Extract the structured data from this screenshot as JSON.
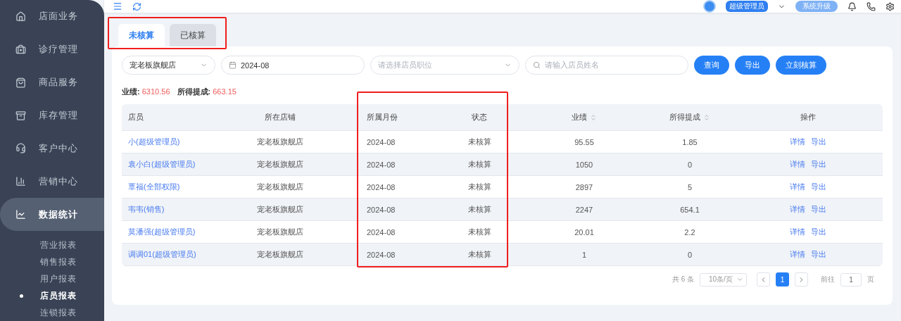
{
  "sidebar": {
    "items": [
      {
        "label": "店面业务",
        "selected": false
      },
      {
        "label": "诊疗管理",
        "selected": false
      },
      {
        "label": "商品服务",
        "selected": false
      },
      {
        "label": "库存管理",
        "selected": false
      },
      {
        "label": "客户中心",
        "selected": false
      },
      {
        "label": "营销中心",
        "selected": false
      },
      {
        "label": "数据统计",
        "selected": true,
        "expanded": true,
        "children": [
          {
            "label": "营业报表",
            "selected": false
          },
          {
            "label": "销售报表",
            "selected": false
          },
          {
            "label": "用户报表",
            "selected": false
          },
          {
            "label": "店员报表",
            "selected": true
          },
          {
            "label": "连锁报表",
            "selected": false
          }
        ]
      }
    ]
  },
  "header": {
    "role_badge": "超级管理员",
    "upgrade_button": "系统升级"
  },
  "tabs": [
    {
      "label": "未核算",
      "selected": true
    },
    {
      "label": "已核算",
      "selected": false
    }
  ],
  "filters": {
    "store_select": {
      "value": "宠老板旗舰店"
    },
    "month_picker": {
      "value": "2024-08"
    },
    "position_select": {
      "placeholder": "请选择店员职位"
    },
    "name_search": {
      "placeholder": "请输入店员姓名"
    }
  },
  "buttons": [
    "查询",
    "导出",
    "立刻核算"
  ],
  "summary": [
    {
      "label": "业绩:",
      "value": "6310.56"
    },
    {
      "label": "所得提成:",
      "value": "663.15"
    }
  ],
  "table": {
    "columns": [
      {
        "label": "店员",
        "sortable": false
      },
      {
        "label": "所在店铺",
        "sortable": false
      },
      {
        "label": "所属月份",
        "sortable": false
      },
      {
        "label": "状态",
        "sortable": false
      },
      {
        "label": "业绩",
        "sortable": true
      },
      {
        "label": "所得提成",
        "sortable": true
      },
      {
        "label": "操作",
        "sortable": false
      }
    ],
    "rows": [
      {
        "clerk": "小(超级管理员)",
        "store": "宠老板旗舰店",
        "month": "2024-08",
        "status": "未核算",
        "performance": "95.55",
        "commission": "1.85",
        "actions": [
          "详情",
          "导出"
        ]
      },
      {
        "clerk": "袁小白(超级管理员)",
        "store": "宠老板旗舰店",
        "month": "2024-08",
        "status": "未核算",
        "performance": "1050",
        "commission": "0",
        "actions": [
          "详情",
          "导出"
        ]
      },
      {
        "clerk": "覃福(全部权限)",
        "store": "宠老板旗舰店",
        "month": "2024-08",
        "status": "未核算",
        "performance": "2897",
        "commission": "5",
        "actions": [
          "详情",
          "导出"
        ]
      },
      {
        "clerk": "韦韦(销售)",
        "store": "宠老板旗舰店",
        "month": "2024-08",
        "status": "未核算",
        "performance": "2247",
        "commission": "654.1",
        "actions": [
          "详情",
          "导出"
        ]
      },
      {
        "clerk": "莫潘强(超级管理员)",
        "store": "宠老板旗舰店",
        "month": "2024-08",
        "status": "未核算",
        "performance": "20.01",
        "commission": "2.2",
        "actions": [
          "详情",
          "导出"
        ]
      },
      {
        "clerk": "调调01(超级管理员)",
        "store": "宠老板旗舰店",
        "month": "2024-08",
        "status": "未核算",
        "performance": "1",
        "commission": "0",
        "actions": [
          "详情",
          "导出"
        ]
      }
    ]
  },
  "pagination": {
    "total": "共 6 条",
    "page_size": "10条/页",
    "pages": [
      {
        "label": "1",
        "selected": true
      }
    ],
    "goto_label": "前往",
    "goto_value": "1",
    "page_suffix": "页"
  }
}
